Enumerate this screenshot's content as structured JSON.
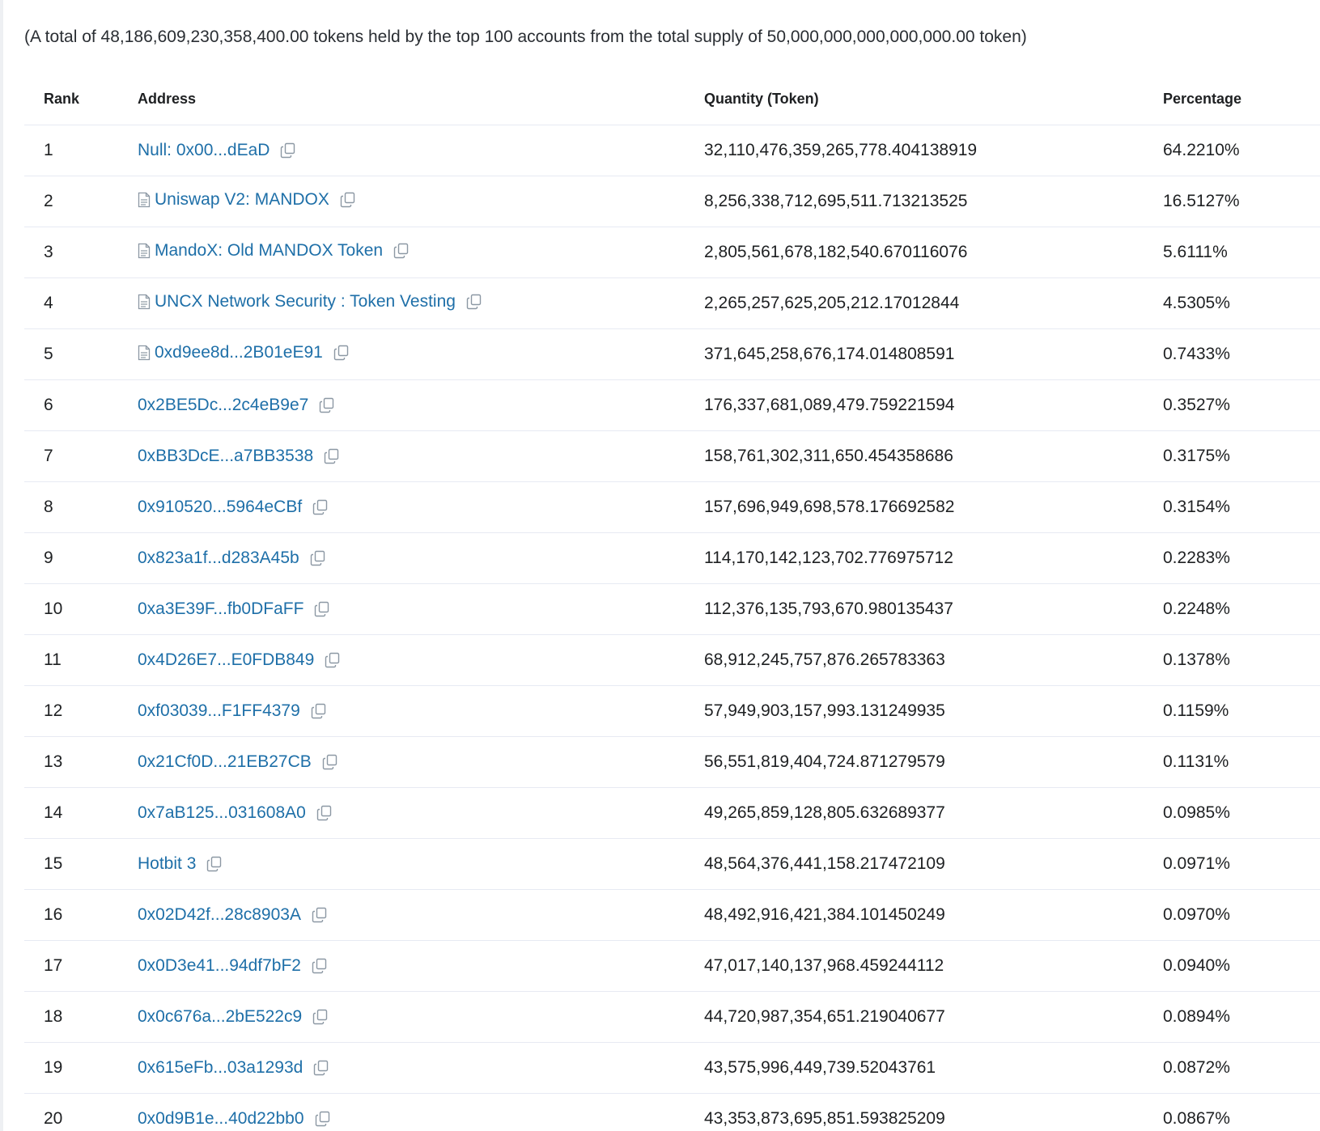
{
  "summary": {
    "text": "(A total of 48,186,609,230,358,400.00 tokens held by the top 100 accounts from the total supply of 50,000,000,000,000,000.00 token)"
  },
  "table": {
    "headers": {
      "rank": "Rank",
      "address": "Address",
      "quantity": "Quantity (Token)",
      "percentage": "Percentage"
    },
    "rows": [
      {
        "rank": "1",
        "address": "Null: 0x00...dEaD",
        "contract": false,
        "quantity": "32,110,476,359,265,778.404138919",
        "percentage": "64.2210%"
      },
      {
        "rank": "2",
        "address": "Uniswap V2: MANDOX",
        "contract": true,
        "quantity": "8,256,338,712,695,511.713213525",
        "percentage": "16.5127%"
      },
      {
        "rank": "3",
        "address": "MandoX: Old MANDOX Token",
        "contract": true,
        "quantity": "2,805,561,678,182,540.670116076",
        "percentage": "5.6111%"
      },
      {
        "rank": "4",
        "address": "UNCX Network Security : Token Vesting",
        "contract": true,
        "quantity": "2,265,257,625,205,212.17012844",
        "percentage": "4.5305%"
      },
      {
        "rank": "5",
        "address": "0xd9ee8d...2B01eE91",
        "contract": true,
        "quantity": "371,645,258,676,174.014808591",
        "percentage": "0.7433%"
      },
      {
        "rank": "6",
        "address": "0x2BE5Dc...2c4eB9e7",
        "contract": false,
        "quantity": "176,337,681,089,479.759221594",
        "percentage": "0.3527%"
      },
      {
        "rank": "7",
        "address": "0xBB3DcE...a7BB3538",
        "contract": false,
        "quantity": "158,761,302,311,650.454358686",
        "percentage": "0.3175%"
      },
      {
        "rank": "8",
        "address": "0x910520...5964eCBf",
        "contract": false,
        "quantity": "157,696,949,698,578.176692582",
        "percentage": "0.3154%"
      },
      {
        "rank": "9",
        "address": "0x823a1f...d283A45b",
        "contract": false,
        "quantity": "114,170,142,123,702.776975712",
        "percentage": "0.2283%"
      },
      {
        "rank": "10",
        "address": "0xa3E39F...fb0DFaFF",
        "contract": false,
        "quantity": "112,376,135,793,670.980135437",
        "percentage": "0.2248%"
      },
      {
        "rank": "11",
        "address": "0x4D26E7...E0FDB849",
        "contract": false,
        "quantity": "68,912,245,757,876.265783363",
        "percentage": "0.1378%"
      },
      {
        "rank": "12",
        "address": "0xf03039...F1FF4379",
        "contract": false,
        "quantity": "57,949,903,157,993.131249935",
        "percentage": "0.1159%"
      },
      {
        "rank": "13",
        "address": "0x21Cf0D...21EB27CB",
        "contract": false,
        "quantity": "56,551,819,404,724.871279579",
        "percentage": "0.1131%"
      },
      {
        "rank": "14",
        "address": "0x7aB125...031608A0",
        "contract": false,
        "quantity": "49,265,859,128,805.632689377",
        "percentage": "0.0985%"
      },
      {
        "rank": "15",
        "address": "Hotbit 3",
        "contract": false,
        "quantity": "48,564,376,441,158.217472109",
        "percentage": "0.0971%"
      },
      {
        "rank": "16",
        "address": "0x02D42f...28c8903A",
        "contract": false,
        "quantity": "48,492,916,421,384.101450249",
        "percentage": "0.0970%"
      },
      {
        "rank": "17",
        "address": "0x0D3e41...94df7bF2",
        "contract": false,
        "quantity": "47,017,140,137,968.459244112",
        "percentage": "0.0940%"
      },
      {
        "rank": "18",
        "address": "0x0c676a...2bE522c9",
        "contract": false,
        "quantity": "44,720,987,354,651.219040677",
        "percentage": "0.0894%"
      },
      {
        "rank": "19",
        "address": "0x615eFb...03a1293d",
        "contract": false,
        "quantity": "43,575,996,449,739.52043761",
        "percentage": "0.0872%"
      },
      {
        "rank": "20",
        "address": "0x0d9B1e...40d22bb0",
        "contract": false,
        "quantity": "43,353,873,695,851.593825209",
        "percentage": "0.0867%"
      }
    ]
  },
  "icons": {
    "copy": "copy-icon",
    "contract": "contract-file-icon"
  },
  "colors": {
    "link": "#1e6fa8",
    "border": "#e7eaf3",
    "icon": "#8c98a4"
  }
}
